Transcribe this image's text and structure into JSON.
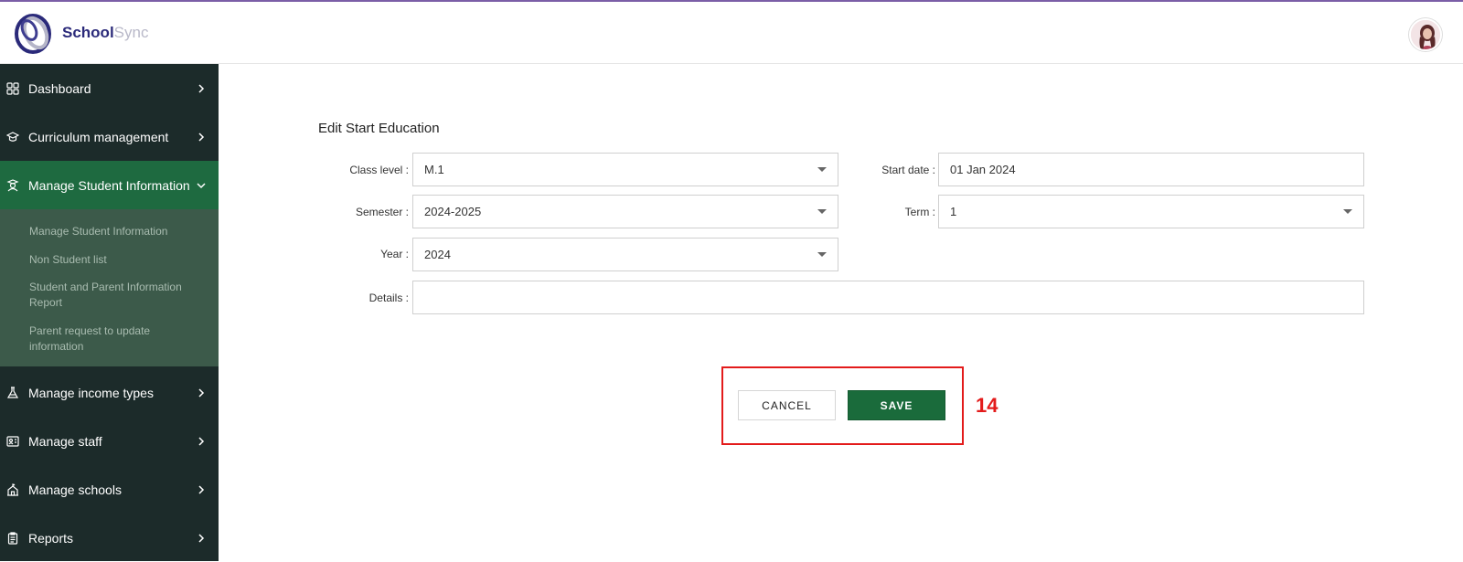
{
  "header": {
    "brand_part1": "School",
    "brand_part2": "Sync",
    "accent_color": "#7b5ea7"
  },
  "sidebar": {
    "items": [
      {
        "label": "Dashboard",
        "icon": "grid-icon"
      },
      {
        "label": "Curriculum management",
        "icon": "graduation-cap-icon"
      },
      {
        "label": "Manage Student Information",
        "icon": "student-icon",
        "active": true
      },
      {
        "label": "Manage income types",
        "icon": "flask-icon"
      },
      {
        "label": "Manage staff",
        "icon": "id-card-icon"
      },
      {
        "label": "Manage schools",
        "icon": "school-building-icon"
      },
      {
        "label": "Reports",
        "icon": "clipboard-icon"
      }
    ],
    "submenu": [
      "Manage Student Information",
      "Non Student list",
      "Student and Parent Information Report",
      "Parent request to update information"
    ]
  },
  "form": {
    "title": "Edit Start Education",
    "class_level_label": "Class level :",
    "class_level_value": "M.1",
    "start_date_label": "Start date :",
    "start_date_value": "01 Jan 2024",
    "semester_label": "Semester :",
    "semester_value": "2024-2025",
    "term_label": "Term :",
    "term_value": "1",
    "year_label": "Year :",
    "year_value": "2024",
    "details_label": "Details :",
    "details_value": ""
  },
  "actions": {
    "cancel_label": "CANCEL",
    "save_label": "SAVE",
    "step_number": "14",
    "save_color": "#1a6b3b",
    "highlight_color": "#e31b1b"
  }
}
